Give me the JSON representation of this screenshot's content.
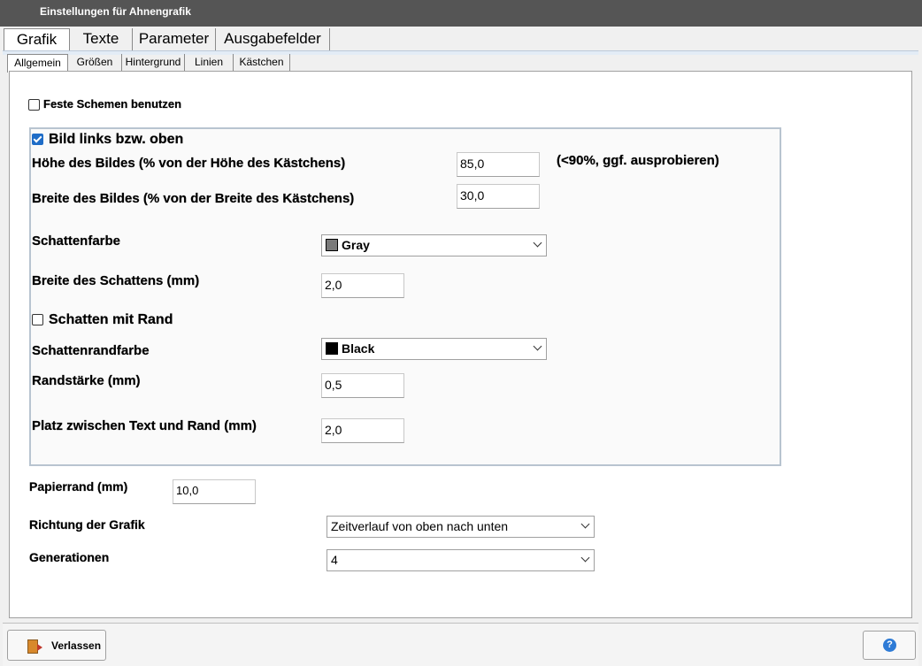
{
  "window": {
    "title": "Einstellungen für Ahnengrafik"
  },
  "main_tabs": [
    {
      "label": "Grafik",
      "active": true
    },
    {
      "label": "Texte",
      "active": false
    },
    {
      "label": "Parameter",
      "active": false
    },
    {
      "label": "Ausgabefelder",
      "active": false
    }
  ],
  "sub_tabs": [
    {
      "label": "Allgemein",
      "active": true
    },
    {
      "label": "Größen",
      "active": false
    },
    {
      "label": "Hintergrund",
      "active": false
    },
    {
      "label": "Linien",
      "active": false
    },
    {
      "label": "Kästchen",
      "active": false
    }
  ],
  "settings": {
    "fixed_schemes": {
      "label": "Feste Schemen benutzen",
      "checked": false
    },
    "image_group": {
      "enable": {
        "label": "Bild links bzw. oben",
        "checked": true
      },
      "image_height": {
        "label": "Höhe des Bildes (% von der Höhe des Kästchens)",
        "value": "85,0",
        "hint": "(<90%, ggf. ausprobieren)"
      },
      "image_width": {
        "label": "Breite des Bildes (% von der Breite des Kästchens)",
        "value": "30,0"
      },
      "shadow_color": {
        "label": "Schattenfarbe",
        "value": "Gray",
        "swatch": "#7a7a7a"
      },
      "shadow_width": {
        "label": "Breite des Schattens (mm)",
        "value": "2,0"
      },
      "shadow_border": {
        "label": "Schatten mit Rand",
        "checked": false
      },
      "shadow_border_color": {
        "label": "Schattenrandfarbe",
        "value": "Black",
        "swatch": "#000000"
      },
      "border_width": {
        "label": "Randstärke (mm)",
        "value": "0,5"
      },
      "text_border_gap": {
        "label": "Platz zwischen Text und Rand (mm)",
        "value": "2,0"
      }
    },
    "paper_margin": {
      "label": "Papierrand (mm)",
      "value": "10,0"
    },
    "direction": {
      "label": "Richtung der Grafik",
      "value": "Zeitverlauf von oben nach unten"
    },
    "generations": {
      "label": "Generationen",
      "value": "4"
    }
  },
  "footer": {
    "exit_label": "Verlassen",
    "help_symbol": "?"
  }
}
